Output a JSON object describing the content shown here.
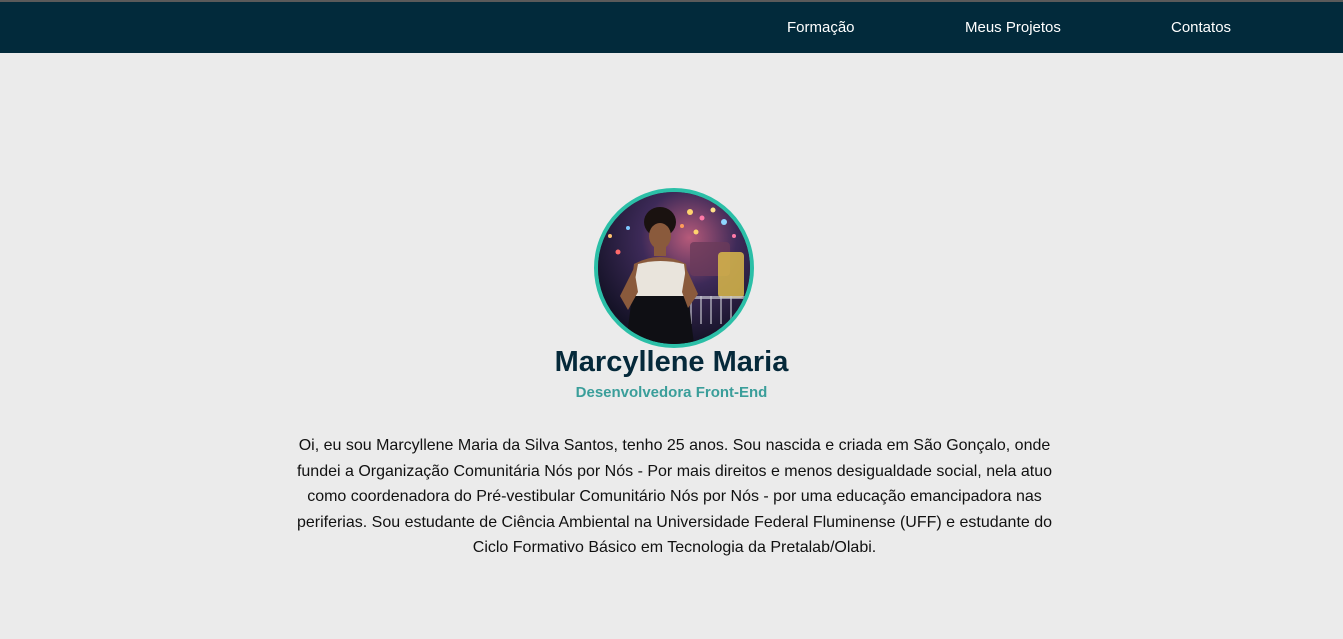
{
  "nav": {
    "links": [
      {
        "label": "Formação"
      },
      {
        "label": "Meus Projetos"
      },
      {
        "label": "Contatos"
      }
    ]
  },
  "profile": {
    "avatar_icon": "profile-photo",
    "name": "Marcyllene Maria",
    "role": "Desenvolvedora Front-End",
    "bio": "Oi, eu sou Marcyllene Maria da Silva Santos, tenho 25 anos. Sou nascida e criada em São Gonçalo, onde fundei a Organização Comunitária Nós por Nós - Por mais direitos e menos desigualdade social, nela atuo como coordenadora do Pré-vestibular Comunitário Nós por Nós - por uma educação emancipadora nas periferias. Sou estudante de Ciência Ambiental na Universidade Federal Fluminense (UFF) e estudante do Ciclo Formativo Básico em Tecnologia da Pretalab/Olabi."
  },
  "colors": {
    "navbar": "#022a3b",
    "page_background": "#ebebeb",
    "name": "#05293a",
    "role": "#3a9e9a",
    "avatar_border": "#2bbfa7"
  }
}
